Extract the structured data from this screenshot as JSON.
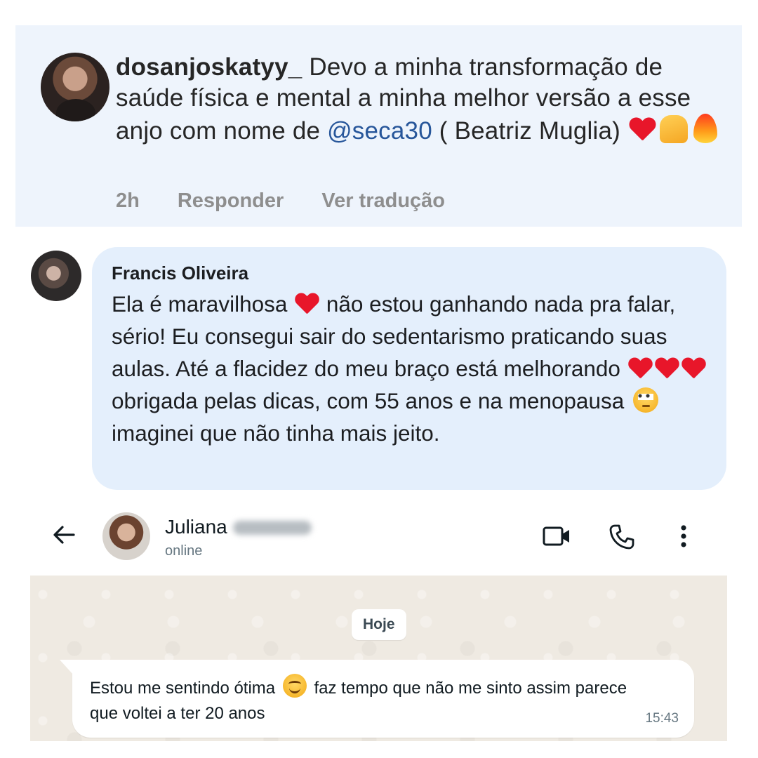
{
  "instagram": {
    "username": "dosanjoskatyy_",
    "text_before_mention": " Devo a minha transformação de saúde física e mental a minha melhor versão a esse anjo com nome de ",
    "mention": "@seca30",
    "text_after_mention": " ( Beatriz Muglia) ",
    "emojis": [
      "heart-icon",
      "raised-hands-icon",
      "fire-icon"
    ],
    "time": "2h",
    "reply_label": "Responder",
    "translate_label": "Ver tradução"
  },
  "facebook": {
    "name": "Francis Oliveira",
    "part1": "Ela é maravilhosa ",
    "part2": " não estou ganhando nada pra falar, sério! Eu consegui sair do sedentarismo praticando suas aulas. Até a flacidez do meu braço está melhorando ",
    "part3": " obrigada pelas dicas, com 55 anos e na menopausa ",
    "part4": " imaginei que não tinha mais jeito.",
    "emojis": [
      "heart-icon",
      "heart-icon",
      "heart-icon",
      "heart-icon",
      "eye-roll-emoji-icon"
    ]
  },
  "whatsapp": {
    "contact_name": "Juliana",
    "status": "online",
    "day_label": "Hoje",
    "message_part1": "Estou me sentindo ótima ",
    "message_part2": " faz tempo que não me sinto assim parece que voltei a ter 20 anos",
    "time": "15:43",
    "icons": [
      "back-arrow-icon",
      "video-call-icon",
      "phone-icon",
      "more-vert-icon",
      "smiling-emoji-icon"
    ],
    "colors": {
      "chat_bg": "#efeae2",
      "bubble": "#ffffff"
    }
  },
  "colors": {
    "ig_panel": "#eef4fc",
    "fb_bubble": "#e4effc",
    "mention": "#27569a",
    "heart": "#e8162a"
  }
}
